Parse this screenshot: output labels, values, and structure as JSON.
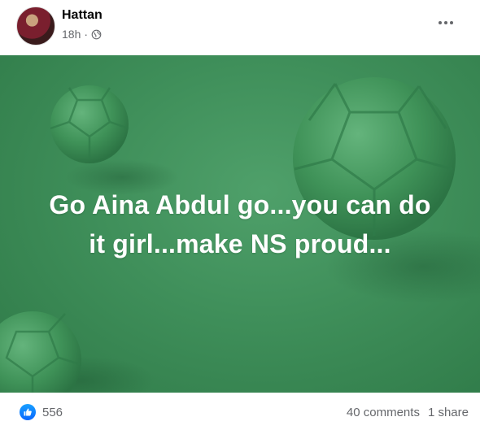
{
  "post": {
    "author": "Hattan",
    "time": "18h",
    "separator": "·",
    "text_line1": "Go Aina Abdul go...you can do",
    "text_line2": "it girl...make NS proud..."
  },
  "stats": {
    "reactions": "556",
    "comments": "40 comments",
    "shares": "1 share"
  },
  "colors": {
    "background": "#3f8f5a",
    "reaction": "#0866ff"
  },
  "icons": {
    "audience": "globe-icon",
    "menu": "more-options-icon",
    "reaction": "like-icon"
  }
}
